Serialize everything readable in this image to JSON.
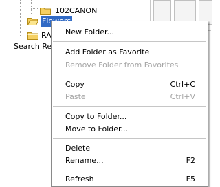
{
  "tree": {
    "items": [
      {
        "label": "102CANON"
      },
      {
        "label": "Flowers"
      },
      {
        "label": "RA"
      },
      {
        "label": "Search Res"
      }
    ]
  },
  "context_menu": {
    "items": [
      {
        "label": "New Folder...",
        "shortcut": "",
        "enabled": true
      },
      {
        "label": "Add Folder as Favorite",
        "shortcut": "",
        "enabled": true
      },
      {
        "label": "Remove Folder from Favorites",
        "shortcut": "",
        "enabled": false
      },
      {
        "label": "Copy",
        "shortcut": "Ctrl+C",
        "enabled": true
      },
      {
        "label": "Paste",
        "shortcut": "Ctrl+V",
        "enabled": false
      },
      {
        "label": "Copy to Folder...",
        "shortcut": "",
        "enabled": true
      },
      {
        "label": "Move to Folder...",
        "shortcut": "",
        "enabled": true
      },
      {
        "label": "Delete",
        "shortcut": "",
        "enabled": true
      },
      {
        "label": "Rename...",
        "shortcut": "F2",
        "enabled": true
      },
      {
        "label": "Refresh",
        "shortcut": "F5",
        "enabled": true
      }
    ]
  },
  "colors": {
    "selection": "#316ac5",
    "folder": "#f5d062",
    "disabled_text": "#a5a5a5"
  }
}
